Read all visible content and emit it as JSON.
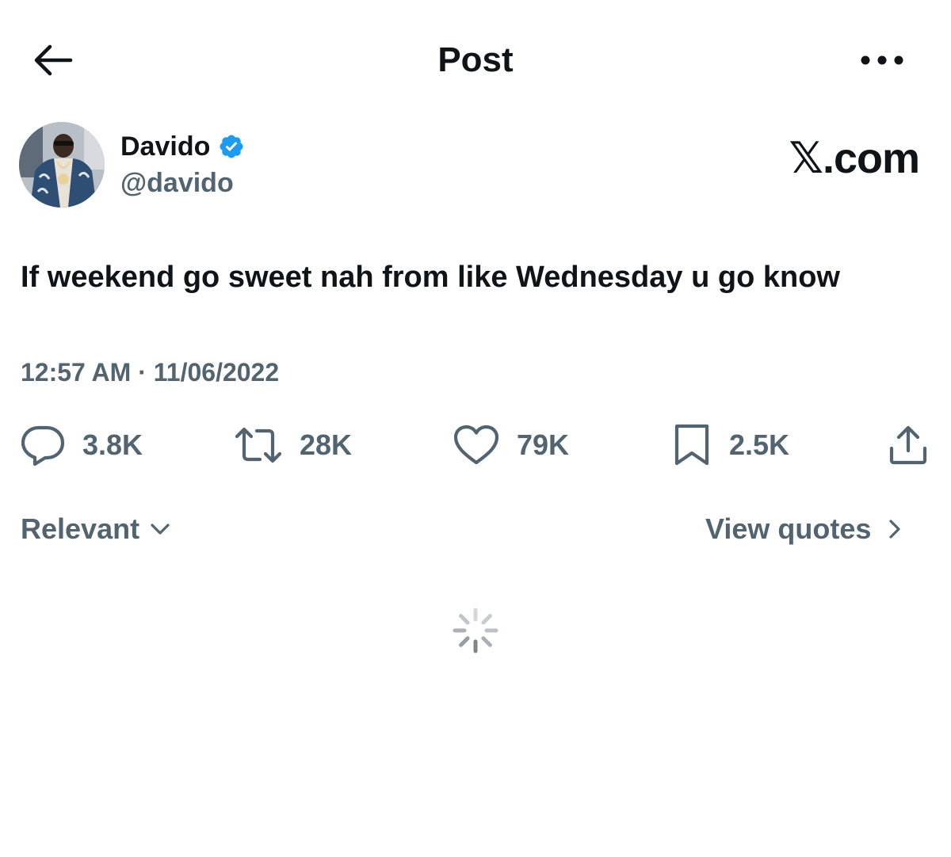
{
  "header": {
    "title": "Post",
    "back_icon": "arrow-left-icon",
    "more_icon": "more-dots-icon"
  },
  "author": {
    "name": "Davido",
    "handle": "@davido",
    "verified_color": "#1d9bf0"
  },
  "watermark": "𝕏.com",
  "post": {
    "text": "If weekend go sweet nah from like Wednesday u go know",
    "time": "12:57 AM",
    "separator": "·",
    "date": "11/06/2022"
  },
  "actions": {
    "replies": "3.8K",
    "reposts": "28K",
    "likes": "79K",
    "bookmarks": "2.5K"
  },
  "sort": {
    "label": "Relevant"
  },
  "quotes": {
    "label": "View quotes"
  },
  "colors": {
    "text": "#0f1419",
    "secondary": "#536471",
    "verified": "#1d9bf0"
  }
}
